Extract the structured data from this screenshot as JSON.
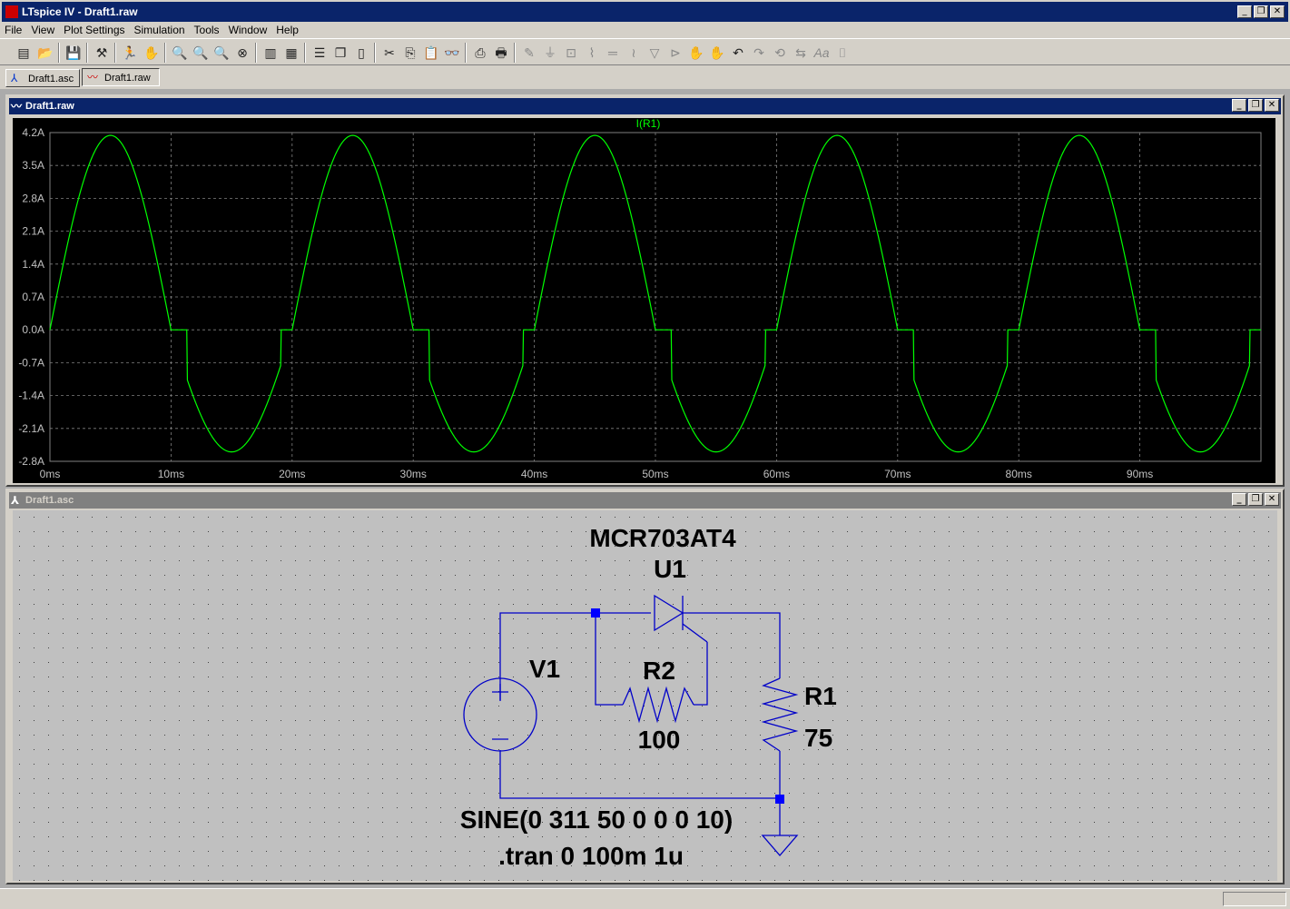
{
  "app": {
    "window_title": "LTspice IV - Draft1.raw"
  },
  "menu": [
    "File",
    "View",
    "Plot Settings",
    "Simulation",
    "Tools",
    "Window",
    "Help"
  ],
  "toolbar": {
    "icons": [
      "new-schematic-icon",
      "open-icon",
      "save-icon",
      "control-panel-icon",
      "run-icon",
      "halt-icon",
      "zoom-in-icon",
      "zoom-out-icon",
      "zoom-fit-icon",
      "zoom-cancel-icon",
      "autorange-icon",
      "manual-limits-icon",
      "tile-horizontal-icon",
      "cascade-icon",
      "tile-vertical-icon",
      "cut-icon",
      "copy-icon",
      "paste-icon",
      "find-icon",
      "print-preview-icon",
      "print-icon",
      "wire-icon",
      "ground-icon",
      "label-icon",
      "resistor-icon",
      "capacitor-icon",
      "inductor-icon",
      "diode-icon",
      "component-icon",
      "move-icon",
      "drag-icon",
      "undo-icon",
      "redo-icon",
      "rotate-icon",
      "mirror-icon",
      "text-icon",
      "spice-directive-icon"
    ]
  },
  "tabs": [
    {
      "label": "Draft1.asc",
      "icon": "schematic-icon",
      "active": false
    },
    {
      "label": "Draft1.raw",
      "icon": "waveform-icon",
      "active": true
    }
  ],
  "plot_window": {
    "title": "Draft1.raw",
    "trace_label": "I(R1)",
    "trace_color": "#00ff00"
  },
  "chart_data": {
    "type": "line",
    "title": "I(R1)",
    "xlabel": "",
    "ylabel": "",
    "x_unit": "ms",
    "y_unit": "A",
    "xlim": [
      0,
      100
    ],
    "ylim": [
      -2.8,
      4.2
    ],
    "x_ticks": [
      "0ms",
      "10ms",
      "20ms",
      "30ms",
      "40ms",
      "50ms",
      "60ms",
      "70ms",
      "80ms",
      "90ms"
    ],
    "y_ticks": [
      "4.2A",
      "3.5A",
      "2.8A",
      "2.1A",
      "1.4A",
      "0.7A",
      "0.0A",
      "-0.7A",
      "-1.4A",
      "-2.1A",
      "-2.8A"
    ],
    "grid": true,
    "series": [
      {
        "name": "I(R1)",
        "color": "#00ff00",
        "frequency_hz": 50,
        "positive_peak": 4.14,
        "negative_peak": -2.6,
        "zero_clamp_windows_ms": [
          [
            10,
            11.3
          ],
          [
            19.1,
            20
          ],
          [
            30,
            31.3
          ],
          [
            39.1,
            40
          ],
          [
            50,
            51.3
          ],
          [
            59.1,
            60
          ],
          [
            70,
            71.3
          ],
          [
            79.1,
            80
          ],
          [
            90,
            91.3
          ],
          [
            99.1,
            100
          ]
        ]
      }
    ]
  },
  "schematic_window": {
    "title": "Draft1.asc",
    "components": {
      "u1_model": "MCR703AT4",
      "u1_name": "U1",
      "v1_name": "V1",
      "v1_value": "SINE(0 311 50 0 0 0 10)",
      "r1_name": "R1",
      "r1_value": "75",
      "r2_name": "R2",
      "r2_value": "100",
      "directive": ".tran 0 100m 1u"
    },
    "wire_color": "#0000c8",
    "junction_color": "#0000ff"
  }
}
